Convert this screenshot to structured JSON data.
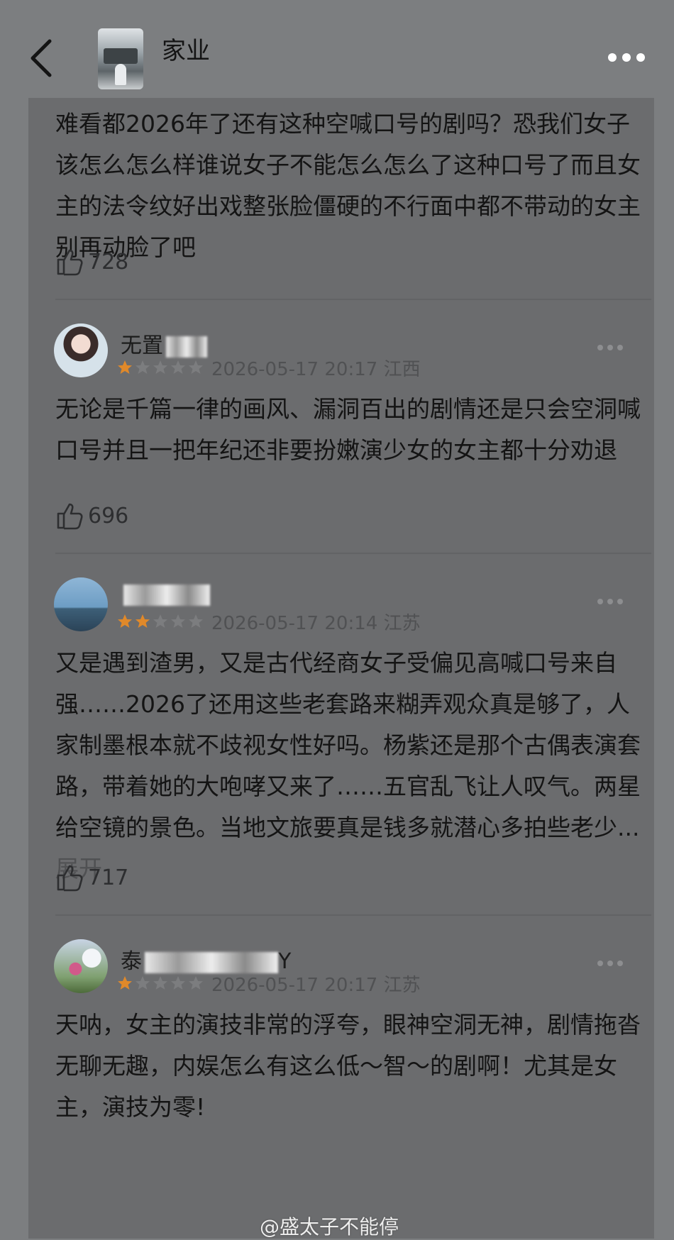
{
  "header": {
    "title": "家业",
    "back_icon": "chevron-left-icon",
    "more_icon": "more-horizontal-icon"
  },
  "review0": {
    "text": "难看都2026年了还有这种空喊口号的剧吗？恐我们女子该怎么怎么样谁说女子不能怎么怎么了这种口号了而且女主的法令纹好出戏整张脸僵硬的不行面中都不带动的女主别再动脸了吧",
    "likes": "728"
  },
  "reviews": [
    {
      "username": "无置",
      "rating": 1,
      "date": "2026-05-17 20:17",
      "location": "江西",
      "text": "无论是千篇一律的画风、漏洞百出的剧情还是只会空洞喊口号并且一把年纪还非要扮嫩演少女的女主都十分劝退",
      "likes": "696"
    },
    {
      "username": "",
      "rating": 2,
      "date": "2026-05-17 20:14",
      "location": "江苏",
      "text": "又是遇到渣男，又是古代经商女子受偏见高喊口号来自强……2026了还用这些老套路来糊弄观众真是够了，人家制墨根本就不歧视女性好吗。杨紫还是那个古偶表演套路，带着她的大咆哮又来了……五官乱飞让人叹气。两星给空镜的景色。当地文旅要真是钱多就潜心多拍些老少...",
      "expand_label": "展开",
      "likes": "717"
    },
    {
      "username": "泰",
      "username_tail": "Y",
      "rating": 1,
      "date": "2026-05-17 20:17",
      "location": "江苏",
      "text": "天呐，女主的演技非常的浮夸，眼神空洞无神，剧情拖沓无聊无趣，内娱怎么有这么低～智～的剧啊！尤其是女主，演技为零!"
    }
  ],
  "watermark": "@盛太子不能停",
  "colors": {
    "star_filled": "#e0892a",
    "star_empty": "#7c7d7f",
    "background": "#7c7e80",
    "card": "#6b6c6e"
  }
}
